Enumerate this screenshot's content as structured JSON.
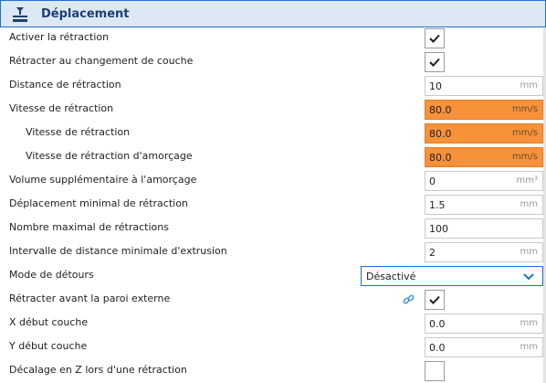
{
  "header": {
    "title": "Déplacement",
    "icon": "travel-icon"
  },
  "settings": {
    "retraction_enable": {
      "label": "Activer la rétraction",
      "checked": true
    },
    "retract_at_layer_change": {
      "label": "Rétracter au changement de couche",
      "checked": true
    },
    "retraction_distance": {
      "label": "Distance de rétraction",
      "value": "10",
      "unit": "mm"
    },
    "retraction_speed": {
      "label": "Vitesse de rétraction",
      "value": "80.0",
      "unit": "mm/s",
      "highlight": "#f7923a"
    },
    "retraction_retract_speed": {
      "label": "Vitesse de rétraction",
      "value": "80.0",
      "unit": "mm/s",
      "highlight": "#f7923a"
    },
    "retraction_prime_speed": {
      "label": "Vitesse de rétraction d'amorçage",
      "value": "80.0",
      "unit": "mm/s",
      "highlight": "#f7923a"
    },
    "retraction_extra_prime_amount": {
      "label": "Volume supplémentaire à l'amorçage",
      "value": "0",
      "unit": "mm³"
    },
    "retraction_min_travel": {
      "label": "Déplacement minimal de rétraction",
      "value": "1.5",
      "unit": "mm"
    },
    "retraction_count_max": {
      "label": "Nombre maximal de rétractions",
      "value": "100",
      "unit": ""
    },
    "retraction_extrusion_window": {
      "label": "Intervalle de distance minimale d'extrusion",
      "value": "2",
      "unit": "mm"
    },
    "retraction_combing": {
      "label": "Mode de détours",
      "value": "Désactivé",
      "icon": "chevron-down-icon"
    },
    "travel_retract_before_outer_wall": {
      "label": "Rétracter avant la paroi externe",
      "checked": true,
      "link_icon": "link-icon"
    },
    "layer_start_x": {
      "label": "X début couche",
      "value": "0.0",
      "unit": "mm"
    },
    "layer_start_y": {
      "label": "Y début couche",
      "value": "0.0",
      "unit": "mm"
    },
    "retraction_hop_enabled": {
      "label": "Décalage en Z lors d'une rétraction",
      "checked": false
    }
  },
  "colors": {
    "accent": "#1e6fcf",
    "header_bg": "#dde8f7",
    "changed_value": "#f7923a"
  }
}
